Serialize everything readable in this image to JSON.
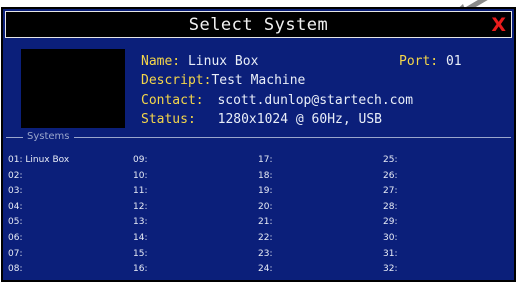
{
  "window": {
    "title": "Select System",
    "close_label": "X"
  },
  "info": {
    "name_label": "Name:",
    "name_value": "Linux Box",
    "port_label": "Port:",
    "port_value": "01",
    "descript_label": "Descript:",
    "descript_value": "Test Machine",
    "contact_label": "Contact:",
    "contact_value": "scott.dunlop@startech.com",
    "status_label": "Status:",
    "status_value": "1280x1024 @ 60Hz, USB"
  },
  "systems": {
    "legend": "Systems",
    "items": [
      "01: Linux Box",
      "02:",
      "03:",
      "04:",
      "05:",
      "06:",
      "07:",
      "08:",
      "09:",
      "10:",
      "11:",
      "12:",
      "13:",
      "14:",
      "15:",
      "16:",
      "17:",
      "18:",
      "19:",
      "20:",
      "21:",
      "22:",
      "23:",
      "24:",
      "25:",
      "26:",
      "27:",
      "28:",
      "29:",
      "30:",
      "31:",
      "32:"
    ]
  },
  "colors": {
    "background": "#0b1f7a",
    "label": "#f4d64a",
    "close": "#e81c1c"
  }
}
